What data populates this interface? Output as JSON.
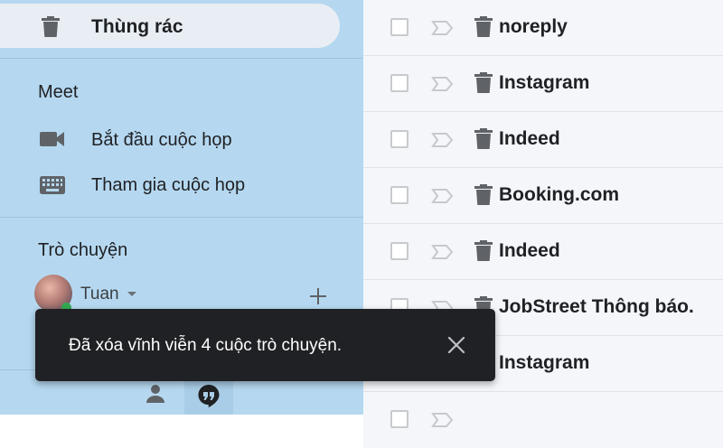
{
  "sidebar": {
    "trash_label": "Thùng rác",
    "meet": {
      "title": "Meet",
      "items": [
        {
          "label": "Bắt đầu cuộc họp",
          "icon": "video-camera-icon"
        },
        {
          "label": "Tham gia cuộc họp",
          "icon": "keyboard-icon"
        }
      ]
    },
    "chat": {
      "title": "Trò chuyện",
      "user_name": "Tuan"
    }
  },
  "mail_list": {
    "rows": [
      {
        "sender": "noreply"
      },
      {
        "sender": "Instagram"
      },
      {
        "sender": "Indeed"
      },
      {
        "sender": "Booking.com"
      },
      {
        "sender": "Indeed"
      },
      {
        "sender": "JobStreet Thông báo."
      },
      {
        "sender": "Instagram"
      }
    ]
  },
  "toast": {
    "message": "Đã xóa vĩnh viễn 4 cuộc trò chuyện."
  },
  "colors": {
    "sidebar_bg": "#b5d8f0",
    "active_item_bg": "#e9eef4",
    "toast_bg": "#202124",
    "online_status": "#34a853"
  }
}
